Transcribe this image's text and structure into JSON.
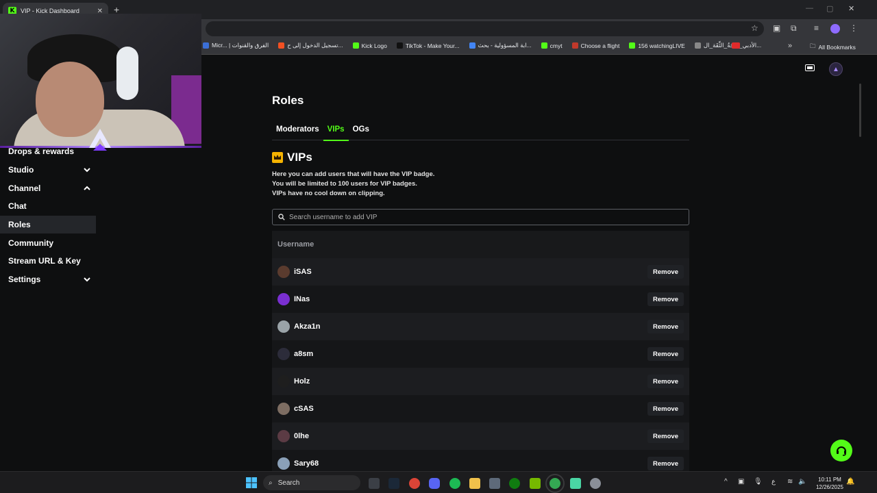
{
  "browser": {
    "tab_title": "VIP - Kick Dashboard",
    "tab_close": "✕",
    "new_tab": "+",
    "all_bookmarks": "All Bookmarks",
    "bookmarks": [
      {
        "label": "Micr... | الفرق والقنوات",
        "color": "#3b6fd6"
      },
      {
        "label": "تسجيل الدخول إلى ح...",
        "color": "#f25022"
      },
      {
        "label": "Kick Logo",
        "color": "#53fc18"
      },
      {
        "label": "TikTok - Make Your...",
        "color": "#111111"
      },
      {
        "label": "ابة المسؤولية - بحث...",
        "color": "#4285f4"
      },
      {
        "label": "cmyt",
        "color": "#53fc18"
      },
      {
        "label": "Choose a flight",
        "color": "#c0392b"
      },
      {
        "label": "156 watchingLIVE",
        "color": "#53fc18"
      },
      {
        "label": "الأدبي_دَرَجَةُ_الثِّقَة_ال...",
        "color": "#888888"
      }
    ]
  },
  "sidebar": {
    "items": [
      {
        "label": "Drops & rewards",
        "chevron": ""
      },
      {
        "label": "Studio",
        "chevron": "down"
      },
      {
        "label": "Channel",
        "chevron": "up"
      },
      {
        "label": "Chat",
        "chevron": ""
      },
      {
        "label": "Roles",
        "chevron": "",
        "active": true
      },
      {
        "label": "Community",
        "chevron": ""
      },
      {
        "label": "Stream URL & Key",
        "chevron": ""
      },
      {
        "label": "Settings",
        "chevron": "down"
      }
    ]
  },
  "main": {
    "title": "Roles",
    "tabs": [
      "Moderators",
      "VIPs",
      "OGs"
    ],
    "active_tab": "VIPs",
    "section_title": "VIPs",
    "description": [
      "Here you can add users that will have the VIP badge.",
      "You will be limited to 100 users for VIP badges.",
      "VIPs have no cool down on clipping."
    ],
    "search_placeholder": "Search username to add VIP",
    "table_header": "Username",
    "remove_label": "Remove",
    "users": [
      {
        "name": "iSAS",
        "avatar_color": "#5a3b2e"
      },
      {
        "name": "INas",
        "avatar_color": "#7a2fd1"
      },
      {
        "name": "Akza1n",
        "avatar_color": "#9aa3a8"
      },
      {
        "name": "a8sm",
        "avatar_color": "#2c2c3a"
      },
      {
        "name": "Holz",
        "avatar_color": "#1e1e1e"
      },
      {
        "name": "cSAS",
        "avatar_color": "#7d6d62"
      },
      {
        "name": "0lhe",
        "avatar_color": "#5b3b44"
      },
      {
        "name": "Sary68",
        "avatar_color": "#8aa0b8"
      }
    ]
  },
  "taskbar": {
    "search_label": "Search",
    "time": "10:11 PM",
    "date": "12/26/2025",
    "lang": "ع"
  },
  "colors": {
    "accent": "#53fc18",
    "background": "#0e0f10"
  }
}
